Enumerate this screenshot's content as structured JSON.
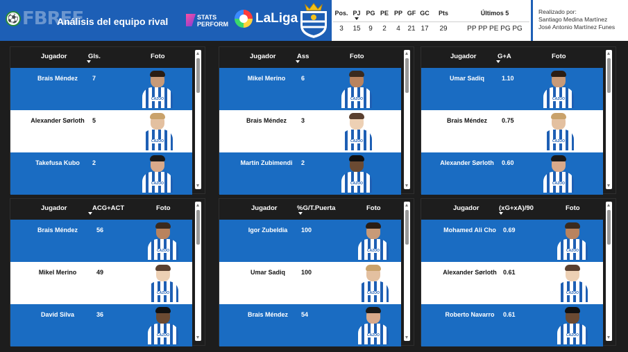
{
  "header": {
    "logo_text": "FBREF",
    "title": "Análisis del equipo rival",
    "stats_logo_line1": "STATS",
    "stats_logo_line2": "PERFORM",
    "laliga_text": "LaLiga",
    "team_stats": {
      "headers": [
        "Pos.",
        "PJ",
        "PG",
        "PE",
        "PP",
        "GF",
        "GC",
        "Pts",
        "Últimos 5"
      ],
      "values": [
        "3",
        "15",
        "9",
        "2",
        "4",
        "21",
        "17",
        "29",
        "PP PP PE PG PG"
      ]
    },
    "credits": {
      "label": "Realizado por:",
      "author1": "Santiago Medina Martínez",
      "author2": "José Antonio Martínez Funes"
    }
  },
  "colors": {
    "header_blue": "#1d5fb6",
    "row_blue": "#1a6cc2",
    "row_white": "#ffffff",
    "background": "#1d1d1d"
  },
  "panels": [
    {
      "col_player": "Jugador",
      "col_stat": "Gls.",
      "col_photo": "Foto",
      "rows": [
        {
          "name": "Brais Méndez",
          "value": "7"
        },
        {
          "name": "Alexander Sørloth",
          "value": "5"
        },
        {
          "name": "Takefusa Kubo",
          "value": "2"
        }
      ]
    },
    {
      "col_player": "Jugador",
      "col_stat": "Ass",
      "col_photo": "Foto",
      "rows": [
        {
          "name": "Mikel Merino",
          "value": "6"
        },
        {
          "name": "Brais Méndez",
          "value": "3"
        },
        {
          "name": "Martín Zubimendi",
          "value": "2"
        }
      ]
    },
    {
      "col_player": "Jugador",
      "col_stat": "G+A",
      "col_photo": "Foto",
      "rows": [
        {
          "name": "Umar Sadiq",
          "value": "1.10"
        },
        {
          "name": "Brais Méndez",
          "value": "0.75"
        },
        {
          "name": "Alexander Sørloth",
          "value": "0.60"
        }
      ]
    },
    {
      "col_player": "Jugador",
      "col_stat": "ACG+ACT",
      "col_photo": "Foto",
      "rows": [
        {
          "name": "Brais Méndez",
          "value": "56"
        },
        {
          "name": "Mikel Merino",
          "value": "49"
        },
        {
          "name": "David Silva",
          "value": "36"
        }
      ]
    },
    {
      "col_player": "Jugador",
      "col_stat": "%G/T.Puerta",
      "col_photo": "Foto",
      "rows": [
        {
          "name": "Igor Zubeldia",
          "value": "100"
        },
        {
          "name": "Umar Sadiq",
          "value": "100"
        },
        {
          "name": "Brais Méndez",
          "value": "54"
        }
      ]
    },
    {
      "col_player": "Jugador",
      "col_stat": "(xG+xA)/90",
      "col_photo": "Foto",
      "rows": [
        {
          "name": "Mohamed Ali Cho",
          "value": "0.69"
        },
        {
          "name": "Alexander Sørloth",
          "value": "0.61"
        },
        {
          "name": "Roberto Navarro",
          "value": "0.61"
        }
      ]
    }
  ]
}
